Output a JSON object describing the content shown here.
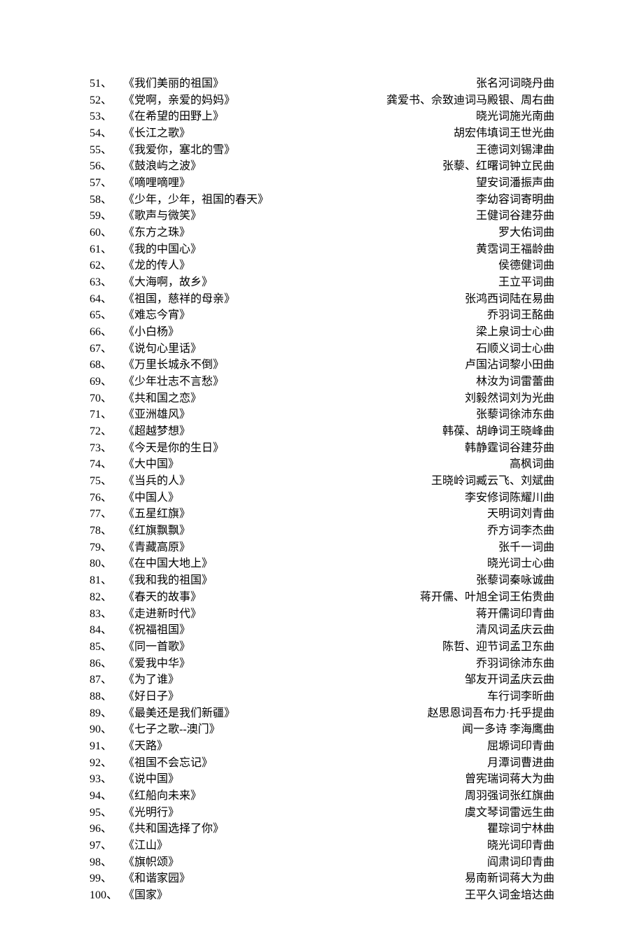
{
  "songs": [
    {
      "number": "51、",
      "title": "《我们美丽的祖国》",
      "credits": "张名河词晓丹曲"
    },
    {
      "number": "52、",
      "title": "《党啊，亲爱的妈妈》",
      "credits": "龚爱书、佘致迪词马殿银、周右曲"
    },
    {
      "number": "53、",
      "title": "《在希望的田野上》",
      "credits": "晓光词施光南曲"
    },
    {
      "number": "54、",
      "title": "《长江之歌》",
      "credits": "胡宏伟填词王世光曲"
    },
    {
      "number": "55、",
      "title": "《我爱你，塞北的雪》",
      "credits": "王德词刘锡津曲"
    },
    {
      "number": "56、",
      "title": "《鼓浪屿之波》",
      "credits": "张藜、红曙词钟立民曲"
    },
    {
      "number": "57、",
      "title": "《嘀哩嘀哩》",
      "credits": "望安词潘振声曲"
    },
    {
      "number": "58、",
      "title": "《少年，少年，祖国的春天》",
      "credits": "李幼容词寄明曲"
    },
    {
      "number": "59、",
      "title": "《歌声与微笑》",
      "credits": "王健词谷建芬曲"
    },
    {
      "number": "60、",
      "title": "《东方之珠》",
      "credits": "罗大佑词曲"
    },
    {
      "number": "61、",
      "title": "《我的中国心》",
      "credits": "黄霑词王福龄曲"
    },
    {
      "number": "62、",
      "title": "《龙的传人》",
      "credits": "侯德健词曲"
    },
    {
      "number": "63、",
      "title": "《大海啊，故乡》",
      "credits": "王立平词曲"
    },
    {
      "number": "64、",
      "title": "《祖国，慈祥的母亲》",
      "credits": "张鸿西词陆在易曲"
    },
    {
      "number": "65、",
      "title": "《难忘今宵》",
      "credits": "乔羽词王酩曲"
    },
    {
      "number": "66、",
      "title": "《小白杨》",
      "credits": "梁上泉词士心曲"
    },
    {
      "number": "67、",
      "title": "《说句心里话》",
      "credits": "石顺义词士心曲"
    },
    {
      "number": "68、",
      "title": "《万里长城永不倒》",
      "credits": "卢国沾词黎小田曲"
    },
    {
      "number": "69、",
      "title": "《少年壮志不言愁》",
      "credits": "林汝为词雷蕾曲"
    },
    {
      "number": "70、",
      "title": "《共和国之恋》",
      "credits": "刘毅然词刘为光曲"
    },
    {
      "number": "71、",
      "title": "《亚洲雄风》",
      "credits": "张藜词徐沛东曲"
    },
    {
      "number": "72、",
      "title": "《超越梦想》",
      "credits": "韩葆、胡峥词王晓峰曲"
    },
    {
      "number": "73、",
      "title": "《今天是你的生日》",
      "credits": "韩静霆词谷建芬曲"
    },
    {
      "number": "74、",
      "title": "《大中国》",
      "credits": "高枫词曲"
    },
    {
      "number": "75、",
      "title": "《当兵的人》",
      "credits": "王晓岭词臧云飞、刘斌曲"
    },
    {
      "number": "76、",
      "title": "《中国人》",
      "credits": "李安修词陈耀川曲"
    },
    {
      "number": "77、",
      "title": "《五星红旗》",
      "credits": "天明词刘青曲"
    },
    {
      "number": "78、",
      "title": "《红旗飘飘》",
      "credits": "乔方词李杰曲"
    },
    {
      "number": "79、",
      "title": "《青藏高原》",
      "credits": "张千一词曲"
    },
    {
      "number": "80、",
      "title": "《在中国大地上》",
      "credits": "晓光词士心曲"
    },
    {
      "number": "81、",
      "title": "《我和我的祖国》",
      "credits": "张藜词秦咏诚曲"
    },
    {
      "number": "82、",
      "title": "《春天的故事》",
      "credits": "蒋开儒、叶旭全词王佑贵曲"
    },
    {
      "number": "83、",
      "title": "《走进新时代》",
      "credits": "蒋开儒词印青曲"
    },
    {
      "number": "84、",
      "title": "《祝福祖国》",
      "credits": "清风词孟庆云曲"
    },
    {
      "number": "85、",
      "title": "《同一首歌》",
      "credits": "陈哲、迎节词孟卫东曲"
    },
    {
      "number": "86、",
      "title": "《爱我中华》",
      "credits": "乔羽词徐沛东曲"
    },
    {
      "number": "87、",
      "title": "《为了谁》",
      "credits": "邹友开词孟庆云曲"
    },
    {
      "number": "88、",
      "title": "《好日子》",
      "credits": "车行词李昕曲"
    },
    {
      "number": "89、",
      "title": "《最美还是我们新疆》",
      "credits": "赵思恩词吾布力·托乎提曲"
    },
    {
      "number": "90、",
      "title": "《七子之歌--澳门》",
      "credits": "闻一多诗  李海鹰曲"
    },
    {
      "number": "91、",
      "title": "《天路》",
      "credits": "屈塬词印青曲"
    },
    {
      "number": "92、",
      "title": "《祖国不会忘记》",
      "credits": "月潭词曹进曲"
    },
    {
      "number": "93、",
      "title": "《说中国》",
      "credits": "曾宪瑞词蒋大为曲"
    },
    {
      "number": "94、",
      "title": "《红船向未来》",
      "credits": "周羽强词张红旗曲"
    },
    {
      "number": "95、",
      "title": "《光明行》",
      "credits": "虞文琴词雷远生曲"
    },
    {
      "number": "96、",
      "title": "《共和国选择了你》",
      "credits": "瞿琮词宁林曲"
    },
    {
      "number": "97、",
      "title": "《江山》",
      "credits": "晓光词印青曲"
    },
    {
      "number": "98、",
      "title": "《旗帜颂》",
      "credits": "阎肃词印青曲"
    },
    {
      "number": "99、",
      "title": "《和谐家园》",
      "credits": "易南新词蒋大为曲"
    },
    {
      "number": "100、",
      "title": "《国家》",
      "credits": "王平久词金培达曲"
    }
  ]
}
